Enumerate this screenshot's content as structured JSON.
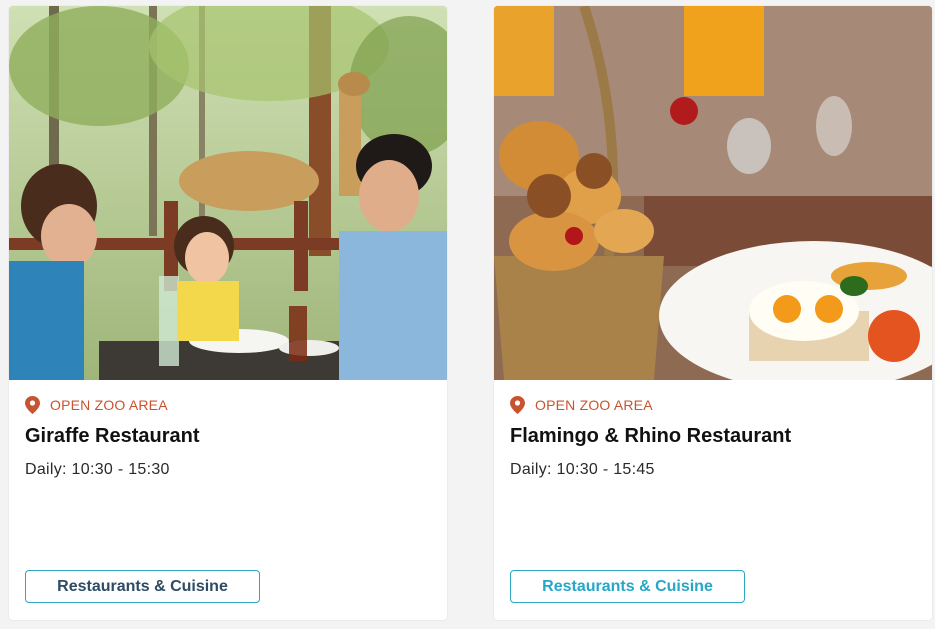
{
  "cards": [
    {
      "location_label": "OPEN ZOO AREA",
      "title": "Giraffe Restaurant",
      "hours": "Daily: 10:30 - 15:30",
      "button_label": "Restaurants & Cuisine",
      "image_subject": "family-dining-with-giraffes"
    },
    {
      "location_label": "OPEN ZOO AREA",
      "title": "Flamingo & Rhino Restaurant",
      "hours": "Daily: 10:30 - 15:45",
      "button_label": "Restaurants & Cuisine",
      "image_subject": "bread-basket-and-eggs"
    }
  ],
  "colors": {
    "location_accent": "#c9532f",
    "button_border": "#2ba7c0",
    "button_text_dark": "#2e4b63",
    "button_text_light": "#27a7c6"
  },
  "icons": {
    "location": "map-pin-icon"
  }
}
